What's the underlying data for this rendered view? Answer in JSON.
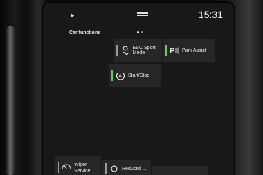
{
  "status_bar": {
    "time": "15:31"
  },
  "header": {
    "title": "Car functions"
  },
  "tiles": {
    "esc_sport": {
      "label": "ESC Sport Mode",
      "icon": "car-skid-icon",
      "active": false
    },
    "park_assist": {
      "label": "Park Assist",
      "icon": "park-assist-icon",
      "active": true
    },
    "start_stop": {
      "label": "Start/Stop",
      "icon": "start-stop-icon",
      "active": true
    },
    "wiper_service": {
      "label": "Wiper Service Position",
      "icon": "wiper-icon",
      "active": false
    },
    "partial_1": {
      "label": "Reduced ..."
    }
  },
  "colors": {
    "active_indicator": "#4fd36a",
    "inactive_indicator": "#9a9a9a",
    "tile_bg": "#262626"
  }
}
